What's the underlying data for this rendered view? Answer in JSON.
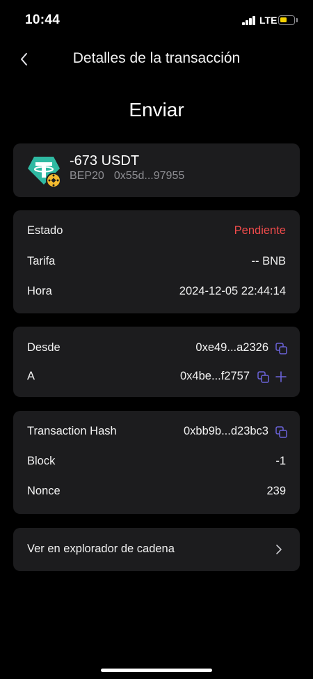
{
  "status_bar": {
    "time": "10:44",
    "network": "LTE",
    "battery_level": 0.45,
    "battery_color": "#f5d200"
  },
  "header": {
    "back_icon": "chevron-left-icon",
    "title": "Detalles de la transacción"
  },
  "page_title": "Enviar",
  "token": {
    "icon": "tether-usdt-icon",
    "badge_icon": "bnb-chain-badge-icon",
    "amount": "-673 USDT",
    "network": "BEP20",
    "contract": "0x55d...97955"
  },
  "details": {
    "status_label": "Estado",
    "status_value": "Pendiente",
    "status_color": "#ef4b4b",
    "fee_label": "Tarifa",
    "fee_value": "-- BNB",
    "time_label": "Hora",
    "time_value": "2024-12-05 22:44:14"
  },
  "addresses": {
    "from_label": "Desde",
    "from_value": "0xe49...a2326",
    "to_label": "A",
    "to_value": "0x4be...f2757",
    "accent_color": "#6b63d9"
  },
  "chain": {
    "hash_label": "Transaction Hash",
    "hash_value": "0xbb9b...d23bc3",
    "block_label": "Block",
    "block_value": "-1",
    "nonce_label": "Nonce",
    "nonce_value": "239"
  },
  "explorer": {
    "label": "Ver en explorador de cadena",
    "icon": "chevron-right-icon"
  }
}
